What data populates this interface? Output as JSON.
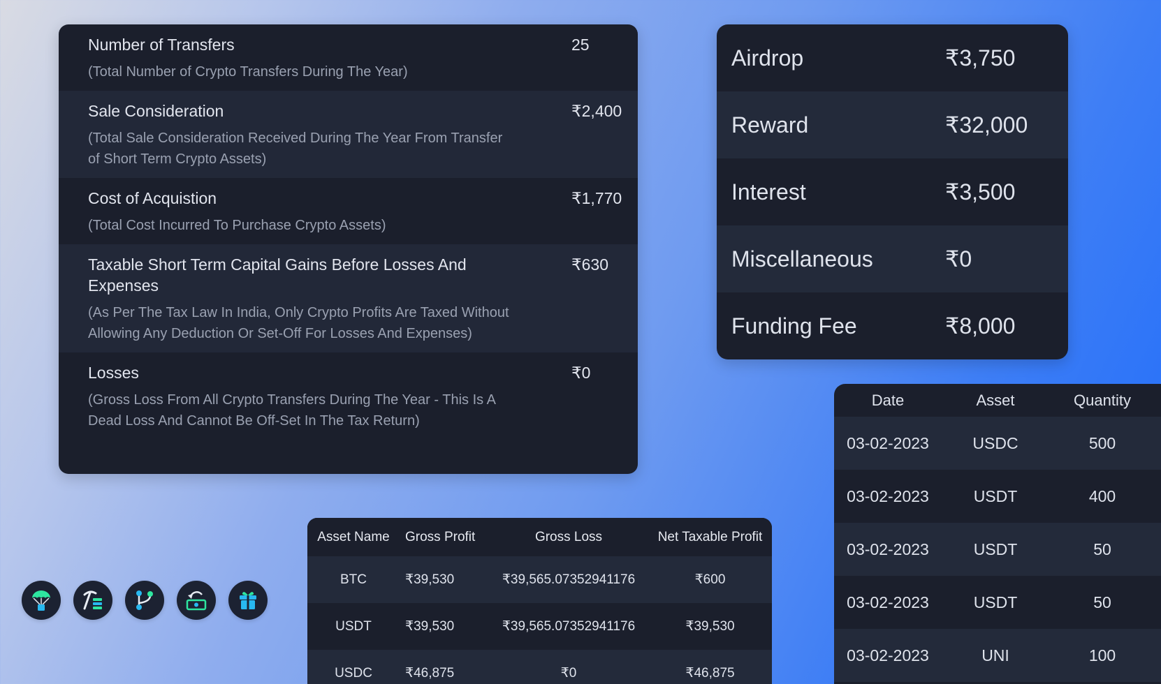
{
  "summary": {
    "rows": [
      {
        "title": "Number of Transfers",
        "desc": "(Total Number of Crypto Transfers During The Year)",
        "value": "25"
      },
      {
        "title": "Sale Consideration",
        "desc": "(Total Sale Consideration Received During The Year From Transfer of Short Term Crypto Assets)",
        "value": "₹2,400"
      },
      {
        "title": "Cost of Acquistion",
        "desc": "(Total Cost Incurred To Purchase Crypto Assets)",
        "value": "₹1,770"
      },
      {
        "title": "Taxable Short Term Capital Gains Before Losses And Expenses",
        "desc": "(As Per The Tax Law In India, Only Crypto Profits Are Taxed Without Allowing Any Deduction Or Set-Off For Losses And Expenses)",
        "value": "₹630"
      },
      {
        "title": "Losses",
        "desc": "(Gross Loss From All Crypto Transfers During The Year - This Is A Dead Loss And Cannot Be Off-Set In The Tax Return)",
        "value": "₹0"
      }
    ]
  },
  "income": {
    "rows": [
      {
        "label": "Airdrop",
        "value": "₹3,750"
      },
      {
        "label": "Reward",
        "value": "₹32,000"
      },
      {
        "label": "Interest",
        "value": "₹3,500"
      },
      {
        "label": "Miscellaneous",
        "value": "₹0"
      },
      {
        "label": "Funding Fee",
        "value": "₹8,000"
      }
    ]
  },
  "gains_table": {
    "headers": [
      "Asset Name",
      "Gross Profit",
      "Gross Loss",
      "Net Taxable Profit"
    ],
    "rows": [
      [
        "BTC",
        "₹39,530",
        "₹39,565.07352941176",
        "₹600"
      ],
      [
        "USDT",
        "₹39,530",
        "₹39,565.07352941176",
        "₹39,530"
      ],
      [
        "USDC",
        "₹46,875",
        "₹0",
        "₹46,875"
      ]
    ]
  },
  "transfers_table": {
    "headers": [
      "Date",
      "Asset",
      "Quantity"
    ],
    "rows": [
      [
        "03-02-2023",
        "USDC",
        "500"
      ],
      [
        "03-02-2023",
        "USDT",
        "400"
      ],
      [
        "03-02-2023",
        "USDT",
        "50"
      ],
      [
        "03-02-2023",
        "USDT",
        "50"
      ],
      [
        "03-02-2023",
        "UNI",
        "100"
      ]
    ]
  },
  "icons": [
    "airdrop-icon",
    "mining-icon",
    "branch-icon",
    "cashback-icon",
    "gift-icon"
  ],
  "colors": {
    "accent_green": "#2ee6a0",
    "accent_blue": "#28b8f0",
    "card_bg": "#1b1f2c",
    "card_alt_bg": "#232a3a"
  }
}
